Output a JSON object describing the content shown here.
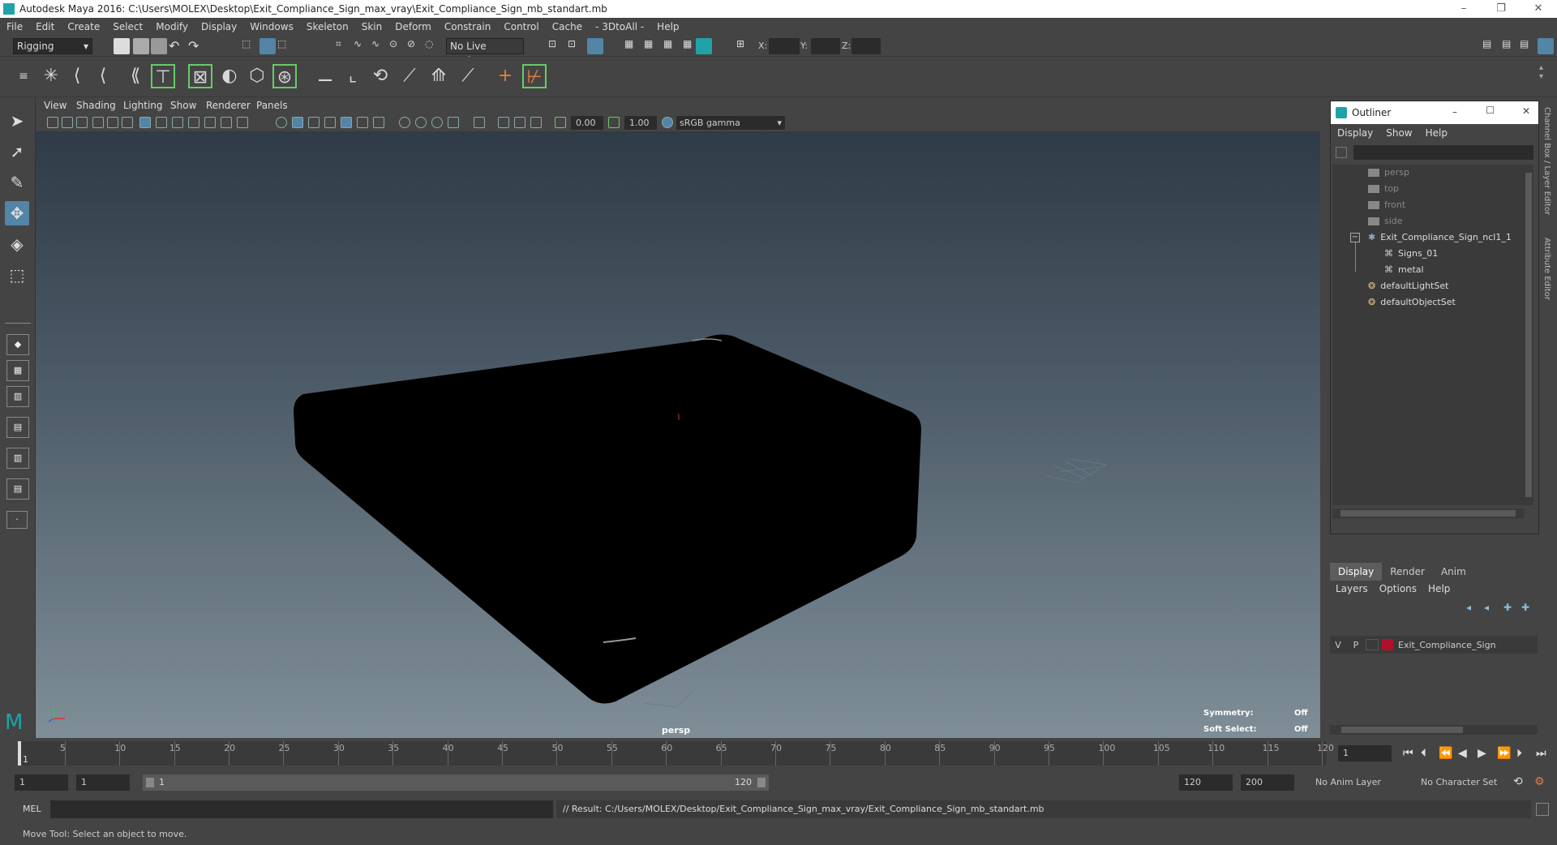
{
  "window": {
    "title": "Autodesk Maya 2016: C:\\Users\\MOLEX\\Desktop\\Exit_Compliance_Sign_max_vray\\Exit_Compliance_Sign_mb_standart.mb",
    "controls": [
      "–",
      "❐",
      "✕"
    ]
  },
  "menubar": [
    "File",
    "Edit",
    "Create",
    "Select",
    "Modify",
    "Display",
    "Windows",
    "Skeleton",
    "Skin",
    "Deform",
    "Constrain",
    "Control",
    "Cache",
    "- 3DtoAll -",
    "Help"
  ],
  "statusline": {
    "mode": "Rigging",
    "live_surface": "No Live Surface",
    "x_label": "X:",
    "y_label": "Y:",
    "z_label": "Z:"
  },
  "viewport": {
    "menu": [
      "View",
      "Shading",
      "Lighting",
      "Show",
      "Renderer",
      "Panels"
    ],
    "exposure": "0.00",
    "gamma": "1.00",
    "color_space": "sRGB gamma",
    "camera_label": "persp",
    "symmetry_label": "Symmetry:",
    "symmetry_value": "Off",
    "soft_select_label": "Soft Select:",
    "soft_select_value": "Off"
  },
  "outliner": {
    "title": "Outliner",
    "menu": [
      "Display",
      "Show",
      "Help"
    ],
    "items": [
      {
        "label": "persp",
        "dim": true
      },
      {
        "label": "top",
        "dim": true
      },
      {
        "label": "front",
        "dim": true
      },
      {
        "label": "side",
        "dim": true
      },
      {
        "label": "Exit_Compliance_Sign_ncl1_1",
        "dim": false
      },
      {
        "label": "Signs_01",
        "dim": false
      },
      {
        "label": "metal",
        "dim": false
      },
      {
        "label": "defaultLightSet",
        "dim": false
      },
      {
        "label": "defaultObjectSet",
        "dim": false
      }
    ],
    "side_tabs": [
      "Channel Box / Layer Editor",
      "Attribute Editor"
    ]
  },
  "layer_editor": {
    "tabs": [
      "Display",
      "Render",
      "Anim"
    ],
    "menu": [
      "Layers",
      "Options",
      "Help"
    ],
    "layer": {
      "v": "V",
      "p": "P",
      "name": "Exit_Compliance_Sign",
      "color": "#b0102a"
    }
  },
  "timeline": {
    "labels": [
      "5",
      "10",
      "15",
      "20",
      "25",
      "30",
      "35",
      "40",
      "45",
      "50",
      "55",
      "60",
      "65",
      "70",
      "75",
      "80",
      "85",
      "90",
      "95",
      "100",
      "105",
      "110",
      "115",
      "120"
    ],
    "start_label": "1",
    "current_frame": "1"
  },
  "range": {
    "start": "1",
    "playback_start": "1",
    "slider_start": "1",
    "slider_end": "120",
    "playback_end": "120",
    "end": "200",
    "anim_layer": "No Anim Layer",
    "character_set": "No Character Set"
  },
  "command": {
    "lang": "MEL",
    "result": "// Result: C:/Users/MOLEX/Desktop/Exit_Compliance_Sign_max_vray/Exit_Compliance_Sign_mb_standart.mb"
  },
  "helpline": "Move Tool: Select an object to move."
}
